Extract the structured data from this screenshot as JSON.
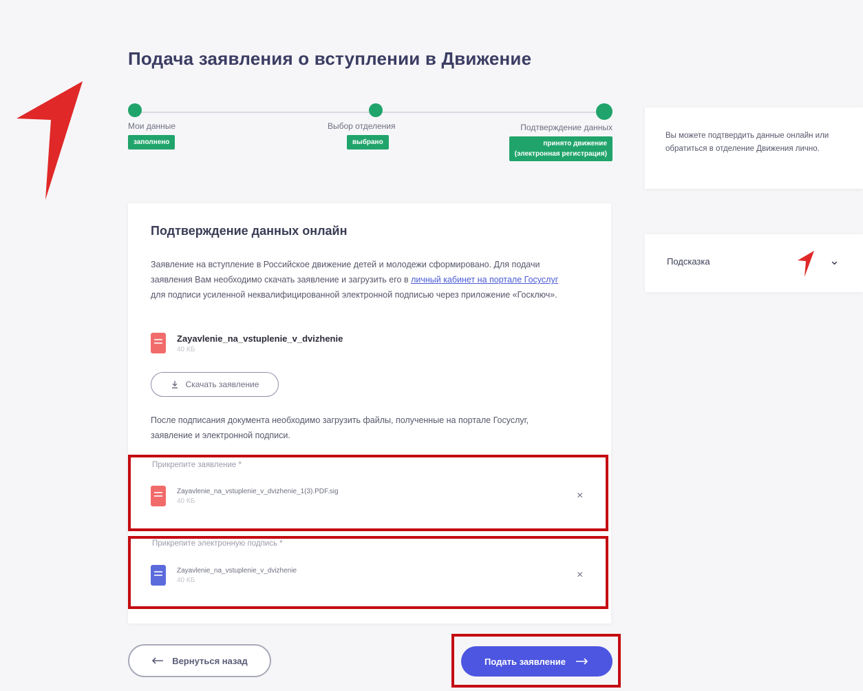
{
  "page": {
    "title": "Подача заявления о вступлении в Движение"
  },
  "stepper": {
    "steps": [
      {
        "label": "Мои данные",
        "badge": "заполнено"
      },
      {
        "label": "Выбор отделения",
        "badge": "выбрано"
      },
      {
        "label": "Подтверждение данных",
        "badge_line1": "принято движение",
        "badge_line2": "(электронная регистрация)"
      }
    ]
  },
  "card": {
    "title": "Подтверждение данных онлайн",
    "text_before_link": "Заявление на вступление в Российское движение детей и молодежи сформировано. Для подачи заявления Вам необходимо скачать заявление и загрузить его в ",
    "link_text": "личный кабинет на портале Госуслуг",
    "text_after_link": " для подписи усиленной неквалифицированной электронной подписью через приложение «Госключ».",
    "file": {
      "name": "Zayavlenie_na_vstuplenie_v_dvizhenie",
      "size": "40 КБ"
    },
    "download_label": "Скачать заявление",
    "after_text": "После подписания документа необходимо загрузить файлы, полученные на портале Госуслуг, заявление и электронной подписи.",
    "attach_statement": {
      "label": "Прикрепите заявление *",
      "file_name": "Zayavlenie_na_vstuplenie_v_dvizhenie_1(3).PDF.sig",
      "file_size": "40 КБ"
    },
    "attach_signature": {
      "label": "Прикрепите электронную подпись *",
      "file_name": "Zayavlenie_na_vstuplenie_v_dvizhenie",
      "file_size": "40 КБ"
    }
  },
  "buttons": {
    "back": "Вернуться назад",
    "submit": "Подать заявление"
  },
  "side": {
    "info_text": "Вы можете подтвердить данные онлайн или обратиться в отделение Движения лично.",
    "hint_label": "Подсказка"
  },
  "colors": {
    "accent_green": "#21a46b",
    "primary_blue": "#4d56e0",
    "highlight_red": "#c40c12",
    "annotation_arrow": "#e02828"
  },
  "icons": [
    "arrow-annotation-icon",
    "doc-pdf-icon",
    "doc-sig-icon",
    "download-icon",
    "close-icon",
    "arrow-left-icon",
    "arrow-right-icon",
    "chevron-down-icon"
  ]
}
